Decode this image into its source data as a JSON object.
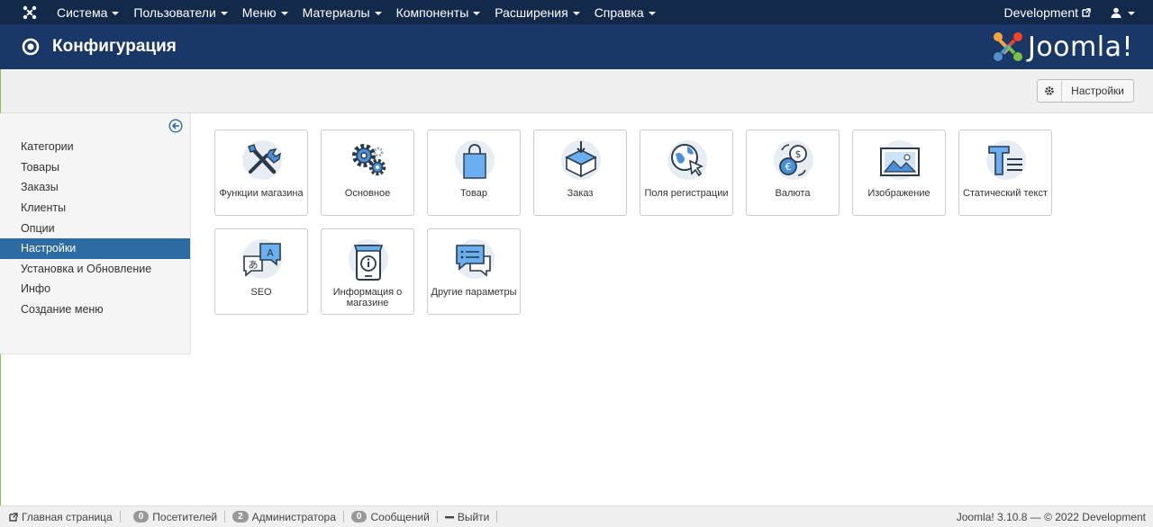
{
  "topnav": {
    "menu": [
      {
        "label": "Система"
      },
      {
        "label": "Пользователи"
      },
      {
        "label": "Меню"
      },
      {
        "label": "Материалы"
      },
      {
        "label": "Компоненты"
      },
      {
        "label": "Расширения"
      },
      {
        "label": "Справка"
      }
    ],
    "site_label": "Development"
  },
  "header": {
    "title": "Конфигурация",
    "brand": "Joomla!"
  },
  "toolbar": {
    "settings_label": "Настройки"
  },
  "sidebar": {
    "items": [
      {
        "label": "Категории"
      },
      {
        "label": "Товары"
      },
      {
        "label": "Заказы"
      },
      {
        "label": "Клиенты"
      },
      {
        "label": "Опции"
      },
      {
        "label": "Настройки",
        "active": true
      },
      {
        "label": "Установка и Обновление"
      },
      {
        "label": "Инфо"
      },
      {
        "label": "Создание меню"
      }
    ]
  },
  "tiles": [
    {
      "label": "Функции магазина",
      "icon": "tools-icon"
    },
    {
      "label": "Основное",
      "icon": "gears-icon"
    },
    {
      "label": "Товар",
      "icon": "shopping-bag-icon"
    },
    {
      "label": "Заказ",
      "icon": "box-icon"
    },
    {
      "label": "Поля регистрации",
      "icon": "globe-cursor-icon"
    },
    {
      "label": "Валюта",
      "icon": "currency-icon"
    },
    {
      "label": "Изображение",
      "icon": "image-icon"
    },
    {
      "label": "Статический текст",
      "icon": "text-icon"
    },
    {
      "label": "SEO",
      "icon": "translate-icon"
    },
    {
      "label": "Информация о магазине",
      "icon": "store-info-icon"
    },
    {
      "label": "Другие параметры",
      "icon": "chat-icon"
    }
  ],
  "footer": {
    "home": "Главная страница",
    "visitors_count": "0",
    "visitors_label": "Посетителей",
    "admins_count": "2",
    "admins_label": "Администратора",
    "messages_count": "0",
    "messages_label": "Сообщений",
    "logout": "Выйти",
    "copyright": "Joomla! 3.10.8 — © 2022 Development"
  },
  "colors": {
    "navbar": "#13294a",
    "header": "#1a3867",
    "active": "#2d6ca2",
    "icon_blue": "#4a90d9"
  }
}
